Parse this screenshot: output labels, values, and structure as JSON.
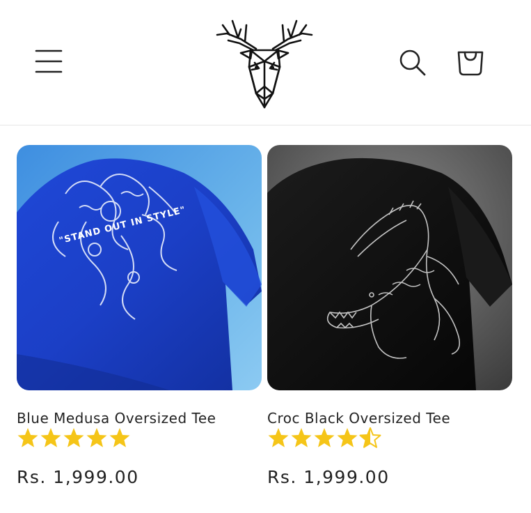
{
  "header": {
    "menu_icon": "hamburger-menu-icon",
    "logo_icon": "geometric-stag-head-logo",
    "search_icon": "search-icon",
    "cart_icon": "shopping-bag-icon"
  },
  "products": [
    {
      "title": "Blue Medusa Oversized Tee",
      "rating": 5,
      "price": "Rs. 1,999.00",
      "print_text": "\"STAND OUT IN STYLE\"",
      "colors": {
        "shirt": "#1b3fc6",
        "background": "#6ab4ea"
      }
    },
    {
      "title": "Croc Black Oversized Tee",
      "rating": 4.5,
      "price": "Rs. 1,999.00",
      "colors": {
        "shirt": "#111111",
        "background": "#5f5f5f"
      }
    }
  ],
  "colors": {
    "star": "#f5c518",
    "text": "#222222",
    "divider": "#e6e6e6"
  }
}
